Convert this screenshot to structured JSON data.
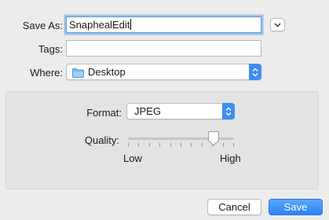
{
  "save_as": {
    "label": "Save As:",
    "value": "SnaphealEdit"
  },
  "tags": {
    "label": "Tags:",
    "value": ""
  },
  "where": {
    "label": "Where:",
    "value": "Desktop"
  },
  "format": {
    "label": "Format:",
    "value": "JPEG"
  },
  "quality": {
    "label": "Quality:",
    "low_label": "Low",
    "high_label": "High",
    "level": 0.81
  },
  "buttons": {
    "cancel": "Cancel",
    "save": "Save"
  },
  "colors": {
    "accent": "#3d8ef2",
    "save_button": "#3a8ef6",
    "panel": "#e3e3e3",
    "window": "#ececec"
  },
  "icons": {
    "where_folder": "folder-icon",
    "disclosure": "chevron-down-icon"
  }
}
